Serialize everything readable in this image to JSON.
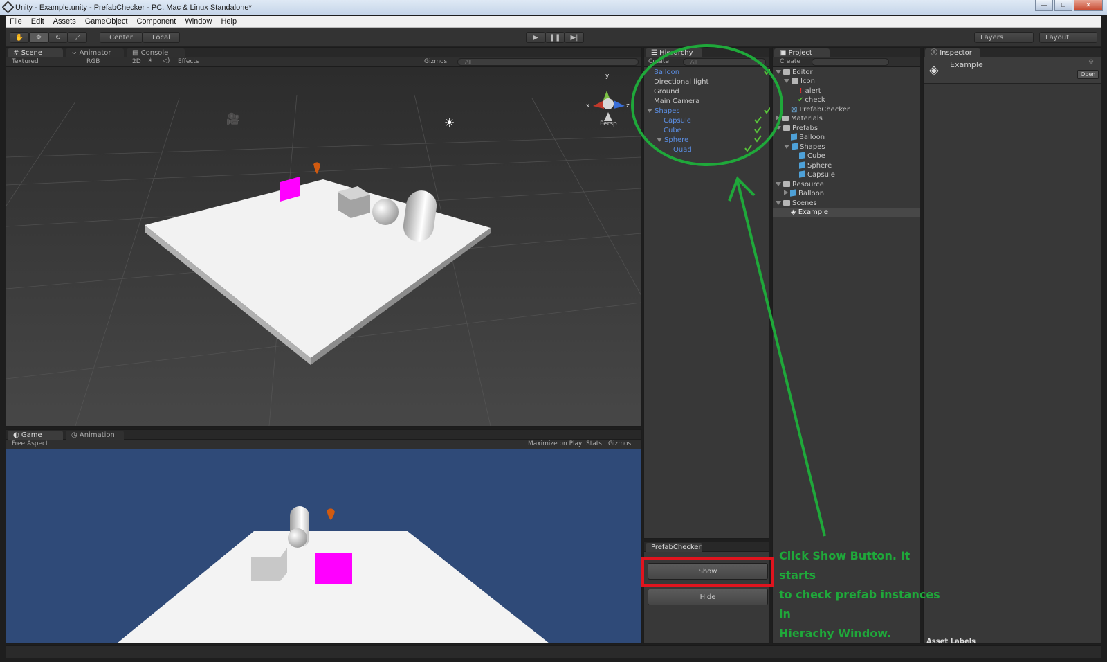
{
  "window": {
    "title": "Unity - Example.unity - PrefabChecker - PC, Mac & Linux Standalone*",
    "min": "—",
    "max": "□",
    "close": "✕"
  },
  "menu": [
    "File",
    "Edit",
    "Assets",
    "GameObject",
    "Component",
    "Window",
    "Help"
  ],
  "toolbar": {
    "center": "Center",
    "local": "Local",
    "layers": "Layers",
    "layout": "Layout"
  },
  "scene": {
    "tabs": [
      "Scene",
      "Animator",
      "Console"
    ],
    "render_mode": "Textured",
    "color_mode": "RGB",
    "mode_2d": "2D",
    "effects": "Effects",
    "gizmos": "Gizmos",
    "search_placeholder": "All",
    "persp": "Persp",
    "axes": {
      "y": "y",
      "x": "x",
      "z": "z"
    }
  },
  "game": {
    "tabs": [
      "Game",
      "Animation"
    ],
    "aspect": "Free Aspect",
    "maximize": "Maximize on Play",
    "stats": "Stats",
    "gizmos": "Gizmos"
  },
  "hierarchy": {
    "tab": "Hierarchy",
    "create": "Create",
    "search_placeholder": "All",
    "items": [
      {
        "label": "Balloon",
        "prefab": true,
        "checked": true
      },
      {
        "label": "Directional light",
        "prefab": false,
        "checked": false
      },
      {
        "label": "Ground",
        "prefab": false,
        "checked": false
      },
      {
        "label": "Main Camera",
        "prefab": false,
        "checked": false
      },
      {
        "label": "Shapes",
        "prefab": true,
        "checked": true
      },
      {
        "label": "Capsule",
        "prefab": true,
        "checked": true
      },
      {
        "label": "Cube",
        "prefab": true,
        "checked": true
      },
      {
        "label": "Sphere",
        "prefab": true,
        "checked": true
      },
      {
        "label": "Quad",
        "prefab": true,
        "checked": true
      }
    ]
  },
  "prefabchecker": {
    "tab": "PrefabChecker",
    "show": "Show",
    "hide": "Hide"
  },
  "project": {
    "tab": "Project",
    "create": "Create",
    "items": [
      {
        "label": "Editor",
        "type": "folder"
      },
      {
        "label": "Icon",
        "type": "folder"
      },
      {
        "label": "alert",
        "type": "alert"
      },
      {
        "label": "check",
        "type": "check"
      },
      {
        "label": "PrefabChecker",
        "type": "script"
      },
      {
        "label": "Materials",
        "type": "folder"
      },
      {
        "label": "Prefabs",
        "type": "folder"
      },
      {
        "label": "Balloon",
        "type": "prefab"
      },
      {
        "label": "Shapes",
        "type": "prefab"
      },
      {
        "label": "Cube",
        "type": "prefab"
      },
      {
        "label": "Sphere",
        "type": "prefab"
      },
      {
        "label": "Capsule",
        "type": "prefab"
      },
      {
        "label": "Resource",
        "type": "folder"
      },
      {
        "label": "Balloon",
        "type": "prefab"
      },
      {
        "label": "Scenes",
        "type": "folder"
      },
      {
        "label": "Example",
        "type": "scene"
      }
    ]
  },
  "inspector": {
    "tab": "Inspector",
    "object": "Example",
    "open": "Open",
    "asset_labels": "Asset Labels"
  },
  "annotation": {
    "lines": [
      "Click Show Button. It starts",
      "to check prefab instances in",
      "Hierachy Window."
    ],
    "color": "#1fa83a"
  },
  "colors": {
    "highlight_box": "#e0141e",
    "magenta": "#ff00ff",
    "game_bg": "#2f4a78"
  }
}
